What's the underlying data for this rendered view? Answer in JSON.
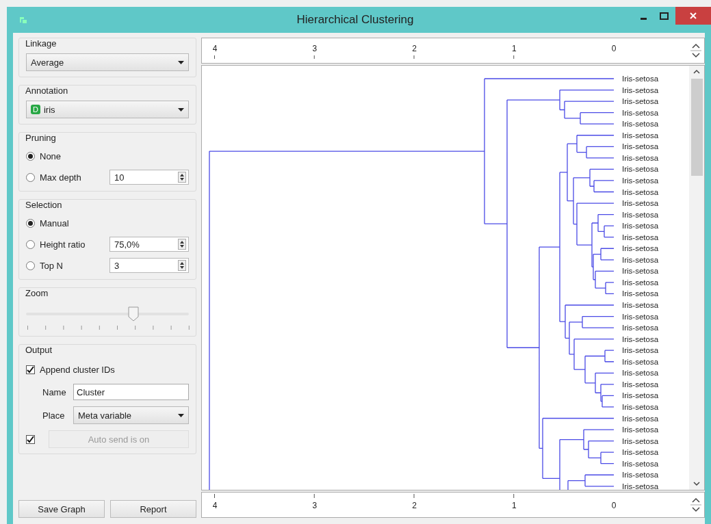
{
  "window": {
    "title": "Hierarchical Clustering"
  },
  "linkage": {
    "title": "Linkage",
    "value": "Average"
  },
  "annotation": {
    "title": "Annotation",
    "badge": "D",
    "value": "iris"
  },
  "pruning": {
    "title": "Pruning",
    "options": [
      {
        "label": "None",
        "selected": true
      },
      {
        "label": "Max depth",
        "selected": false,
        "value": "10"
      }
    ]
  },
  "selection": {
    "title": "Selection",
    "options": [
      {
        "label": "Manual",
        "selected": true
      },
      {
        "label": "Height ratio",
        "selected": false,
        "value": "75,0%"
      },
      {
        "label": "Top N",
        "selected": false,
        "value": "3"
      }
    ]
  },
  "zoom": {
    "title": "Zoom",
    "level": 0.66
  },
  "output": {
    "title": "Output",
    "append": {
      "label": "Append cluster IDs",
      "checked": true
    },
    "name": {
      "label": "Name",
      "value": "Cluster"
    },
    "place": {
      "label": "Place",
      "value": "Meta variable"
    },
    "auto_send": {
      "checked": true,
      "label": "Auto send is on",
      "disabled": true
    }
  },
  "buttons": [
    "Save Graph",
    "Report"
  ],
  "top_axis": {
    "ticks": [
      "4",
      "3",
      "2",
      "1",
      "0"
    ]
  },
  "bottom_axis": {
    "ticks": [
      "4",
      "3",
      "2",
      "1",
      "0"
    ]
  },
  "leaves": [
    "Iris-setosa",
    "Iris-setosa",
    "Iris-setosa",
    "Iris-setosa",
    "Iris-setosa",
    "Iris-setosa",
    "Iris-setosa",
    "Iris-setosa",
    "Iris-setosa",
    "Iris-setosa",
    "Iris-setosa",
    "Iris-setosa",
    "Iris-setosa",
    "Iris-setosa",
    "Iris-setosa",
    "Iris-setosa",
    "Iris-setosa",
    "Iris-setosa",
    "Iris-setosa",
    "Iris-setosa",
    "Iris-setosa",
    "Iris-setosa",
    "Iris-setosa",
    "Iris-setosa",
    "Iris-setosa",
    "Iris-setosa",
    "Iris-setosa",
    "Iris-setosa",
    "Iris-setosa",
    "Iris-setosa",
    "Iris-setosa",
    "Iris-setosa",
    "Iris-setosa",
    "Iris-setosa",
    "Iris-setosa",
    "Iris-setosa",
    "Iris-setosa"
  ]
}
